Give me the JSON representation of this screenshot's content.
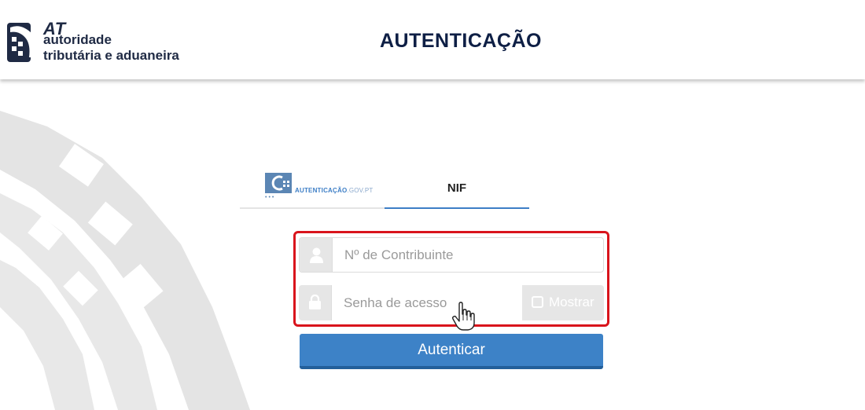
{
  "header": {
    "logo": {
      "line1": "AT",
      "line2": "autoridade",
      "line3": "tributária e aduaneira"
    },
    "title": "AUTENTICAÇÃO"
  },
  "tabs": [
    {
      "label_bold": "AUTENTICAÇÃO",
      "label_thin": ".GOV.PT",
      "icon": "autenticacao-gov-icon",
      "active": false
    },
    {
      "label": "NIF",
      "active": true
    }
  ],
  "form": {
    "nif_field": {
      "placeholder": "Nº de Contribuinte",
      "value": "",
      "icon": "user-icon"
    },
    "password_field": {
      "placeholder": "Senha de acesso",
      "value": "",
      "icon": "lock-icon"
    },
    "show_password": {
      "label": "Mostrar",
      "checked": false
    },
    "submit_label": "Autenticar"
  },
  "colors": {
    "accent": "#3d82c7",
    "highlight_border": "#d9141c",
    "title": "#0e1f45"
  }
}
